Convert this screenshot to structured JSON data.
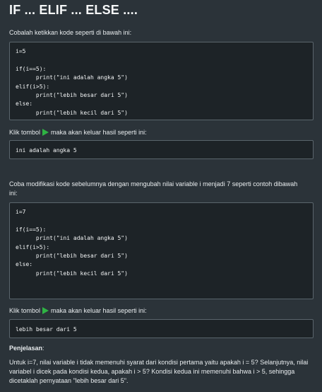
{
  "title": "IF ... ELIF ... ELSE ....",
  "intro": "Cobalah ketikkan kode seperti di bawah ini:",
  "code1": {
    "lines": [
      "i=5",
      "",
      "if(i==5):",
      "      print(\"ini adalah angka 5\")",
      "elif(i>5):",
      "      print(\"lebih besar dari 5\")",
      "else:",
      "      print(\"lebih kecil dari 5\")"
    ]
  },
  "run_hint_1": {
    "before": "Klik tombol",
    "icon": "play-icon",
    "after": "maka akan keluar hasil seperti ini:"
  },
  "output1": "ini adalah angka 5",
  "modify_text": "Coba modifikasi kode sebelumnya dengan mengubah nilai variable i menjadi 7 seperti contoh dibawah ini:",
  "code2": {
    "lines": [
      "i=7",
      "",
      "if(i==5):",
      "      print(\"ini adalah angka 5\")",
      "elif(i>5):",
      "      print(\"lebih besar dari 5\")",
      "else:",
      "      print(\"lebih kecil dari 5\")"
    ]
  },
  "run_hint_2": {
    "before": "Klik tombol",
    "icon": "play-icon",
    "after": "maka akan keluar hasil seperti ini:"
  },
  "output2": "lebih besar dari 5",
  "explanation_heading": "Penjelasan",
  "explanation_colon": ":",
  "explanation_text": "Untuk i=7, nilai variable i tidak memenuhi syarat dari kondisi pertama yaitu apakah i = 5? Selanjutnya, nilai variabel i dicek pada kondisi kedua, apakah i > 5? Kondisi kedua ini memenuhi bahwa i > 5, sehingga dicetaklah pernyataan \"lebih besar dari 5\".",
  "colors": {
    "background": "#2b3339",
    "code_background": "#1d2327",
    "code_border": "#5a656c",
    "play_green": "#2fb344"
  }
}
